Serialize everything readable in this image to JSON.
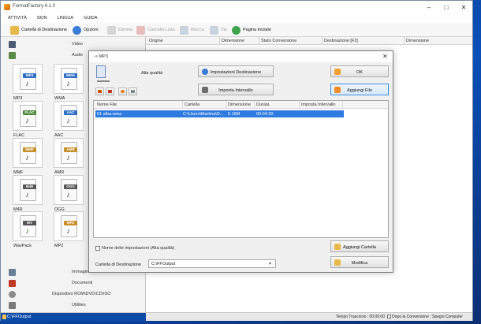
{
  "app": {
    "title": "FormatFactory 4.1.0"
  },
  "menu": [
    "ATTIVITÀ",
    "SKIN",
    "LINGUA",
    "GUIDA"
  ],
  "toolbar": {
    "destination": "Cartella di Destinazione",
    "options": "Opzioni",
    "remove": "Elimina",
    "clear": "Cancella Lista",
    "stop": "Blocca",
    "start": "Via",
    "home": "Pagina Iniziale"
  },
  "sidebar": {
    "categories_top": [
      "Video",
      "Audio"
    ],
    "formats": [
      {
        "name": "MP3",
        "badge": "MP3",
        "color": "#2f6fc6"
      },
      {
        "name": "WMA",
        "badge": "WMA",
        "color": "#2f6fc6"
      },
      {
        "name": "FLAC",
        "badge": "FLAC",
        "color": "#4a8a3a"
      },
      {
        "name": "AAC",
        "badge": "AAC",
        "color": "#2f6fc6"
      },
      {
        "name": "MMF",
        "badge": "MMF",
        "color": "#c8902a"
      },
      {
        "name": "AMR",
        "badge": "AMR",
        "color": "#c8902a"
      },
      {
        "name": "M4R",
        "badge": "M4R",
        "color": "#555555"
      },
      {
        "name": "OGG",
        "badge": "OGG",
        "color": "#555555"
      },
      {
        "name": "WavPack",
        "badge": "WV",
        "color": "#555555"
      },
      {
        "name": "MP2",
        "badge": "MP2",
        "color": "#c8902a"
      }
    ],
    "categories_bottom": [
      "Immagine",
      "Documenti",
      "Dispositivo ROM\\DVD\\CD\\ISO",
      "Utilities"
    ]
  },
  "main_table": {
    "columns": [
      "Origine",
      "Dimensione",
      "Stato Conversione",
      "Destinazione [F2]",
      "Dimensione"
    ]
  },
  "status": {
    "output_path": "C:\\FFOutput",
    "elapsed": "Tempo Trascorso : 00:00:00",
    "after": "Dopo la Conversione : Spegni Computer"
  },
  "dialog": {
    "title": "-> MP3",
    "quality": "Alta qualità",
    "buttons": {
      "dest_settings": "Impostazioni Destinazione",
      "ok": "OK",
      "set_interval": "Imposta Intervallo",
      "add_file": "Aggiungi File",
      "add_folder": "Aggiungi Cartella",
      "modify": "Modifica"
    },
    "file_table": {
      "columns": [
        "Nome File",
        "Cartella",
        "Dimensione",
        "Durata",
        "Imposta Intervallo"
      ],
      "rows": [
        {
          "name": "01 alba.wma",
          "folder": "C:\\Users\\Martina\\D...",
          "size": "6.18M",
          "duration": "00:04:30",
          "interval": ""
        }
      ]
    },
    "name_option": "Nome delle impostazioni (Alta qualità)",
    "dest_label": "Cartella di Destinazione",
    "dest_value": "C:\\FFOutput"
  }
}
